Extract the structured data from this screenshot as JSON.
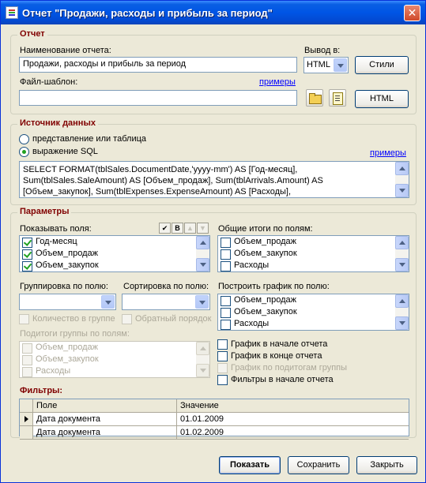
{
  "window": {
    "title": "Отчет \"Продажи, расходы и прибыль за период\"",
    "close_glyph": "✕"
  },
  "report": {
    "group_title": "Отчет",
    "name_label": "Наименование отчета:",
    "name_value": "Продажи, расходы и прибыль за период",
    "output_label": "Вывод в:",
    "output_value": "HTML",
    "styles_button": "Стили",
    "template_label": "Файл-шаблон:",
    "template_value": "",
    "examples_link": "примеры",
    "html_button": "HTML"
  },
  "source": {
    "group_title": "Источник данных",
    "option_view": "представление или таблица",
    "option_sql": "выражение SQL",
    "selected": "sql",
    "examples_link": "примеры",
    "sql_text": "SELECT FORMAT(tblSales.DocumentDate,'yyyy-mm') AS [Год-месяц],\nSum(tblSales.SaleAmount) AS [Объем_продаж], Sum(tblArrivals.Amount) AS\n[Объем_закупок], Sum(tblExpenses.ExpenseAmount) AS [Расходы],"
  },
  "params": {
    "group_title": "Параметры",
    "show_fields_label": "Показывать поля:",
    "toolbar": {
      "check_all": "✔",
      "bold": "B",
      "up": "▲",
      "down": "▼"
    },
    "show_fields": [
      {
        "label": "Год-месяц",
        "checked": true
      },
      {
        "label": "Объем_продаж",
        "checked": true
      },
      {
        "label": "Объем_закупок",
        "checked": true
      }
    ],
    "totals_label": "Общие итоги по полям:",
    "totals_fields": [
      {
        "label": "Объем_продаж",
        "checked": false
      },
      {
        "label": "Объем_закупок",
        "checked": false
      },
      {
        "label": "Расходы",
        "checked": false
      }
    ],
    "group_by_label": "Группировка по полю:",
    "group_by_value": "",
    "sort_by_label": "Сортировка по полю:",
    "sort_by_value": "",
    "count_in_group": "Количество в группе",
    "reverse_order": "Обратный порядок",
    "subtotals_label": "Подитоги группы по полям:",
    "subtotals_fields": [
      {
        "label": "Объем_продаж",
        "checked": false
      },
      {
        "label": "Объем_закупок",
        "checked": false
      },
      {
        "label": "Расходы",
        "checked": false
      }
    ],
    "chart_by_label": "Построить график по полю:",
    "chart_fields": [
      {
        "label": "Объем_продаж",
        "checked": false
      },
      {
        "label": "Объем_закупок",
        "checked": false
      },
      {
        "label": "Расходы",
        "checked": false
      }
    ],
    "chart_at_start": "График в начале отчета",
    "chart_at_end": "График в конце отчета",
    "chart_by_subtotals": "График по подитогам группы",
    "filters_at_start": "Фильтры в начале отчета"
  },
  "filters": {
    "title": "Фильтры:",
    "columns": [
      "Поле",
      "Значение"
    ],
    "rows": [
      {
        "field": "Дата документа",
        "value": "01.01.2009"
      },
      {
        "field": "Дата документа",
        "value": "01.02.2009"
      }
    ]
  },
  "footer": {
    "show_button": "Показать",
    "save_button": "Сохранить",
    "close_button": "Закрыть"
  }
}
